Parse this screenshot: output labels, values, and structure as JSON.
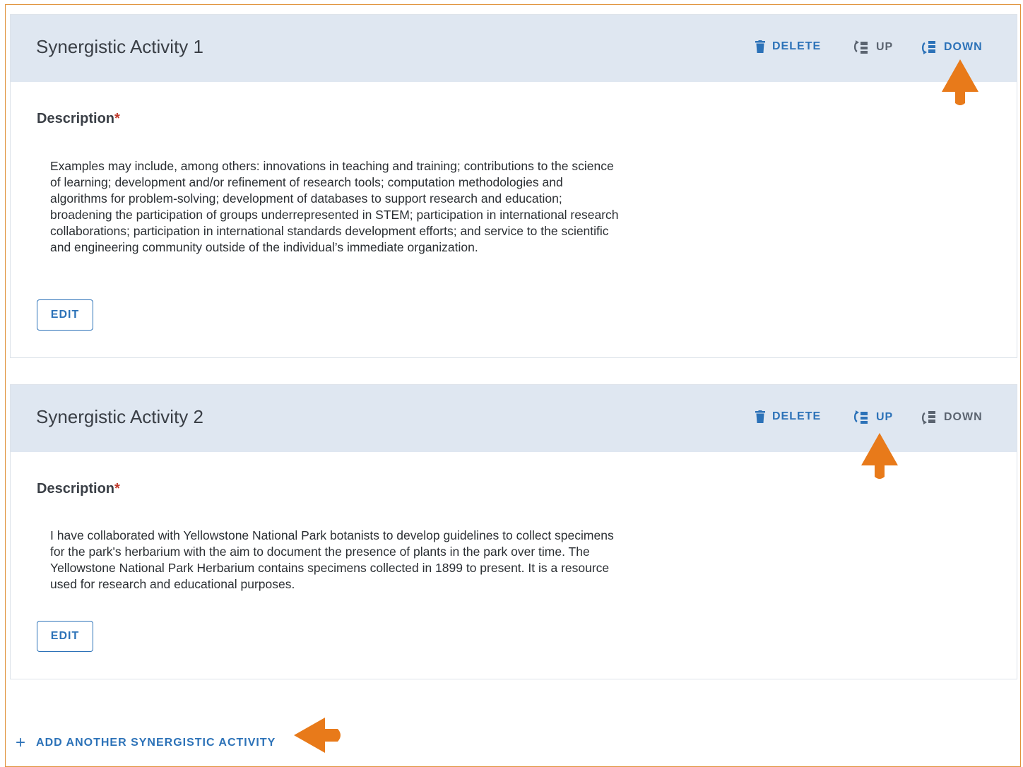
{
  "cards": [
    {
      "title": "Synergistic Activity 1",
      "actions": {
        "delete": "DELETE",
        "up": "UP",
        "down": "DOWN"
      },
      "description_label": "Description",
      "required_mark": "*",
      "description": "Examples may include, among others: innovations in teaching and training; contributions to the science of learning; development and/or refinement of research tools; computation methodologies and algorithms for problem-solving; development of databases to support research and education; broadening the participation of groups underrepresented in STEM; participation in international research collaborations; participation in international standards development efforts; and service to the scientific and engineering community outside of the individual’s immediate organization.",
      "edit_label": "EDIT"
    },
    {
      "title": "Synergistic Activity 2",
      "actions": {
        "delete": "DELETE",
        "up": "UP",
        "down": "DOWN"
      },
      "description_label": "Description",
      "required_mark": "*",
      "description": "I have collaborated with Yellowstone National Park botanists to develop guidelines to collect specimens for the park's herbarium with the aim to document the presence of plants in the park over time. The Yellowstone National Park Herbarium contains specimens collected in 1899 to present. It is a resource used for research and educational purposes.",
      "edit_label": "EDIT"
    }
  ],
  "add_another": {
    "icon": "+",
    "label": "ADD ANOTHER SYNERGISTIC ACTIVITY"
  },
  "colors": {
    "accent": "#2c72b8",
    "header_bg": "#dfe7f1",
    "muted": "#5b6470",
    "required": "#c0392b",
    "callout_arrow": "#e87a1a",
    "frame": "#e0923a"
  },
  "icons": {
    "delete": "trash-icon",
    "up": "move-up-icon",
    "down": "move-down-icon",
    "add": "plus-icon",
    "callout": "orange-callout-arrow"
  }
}
